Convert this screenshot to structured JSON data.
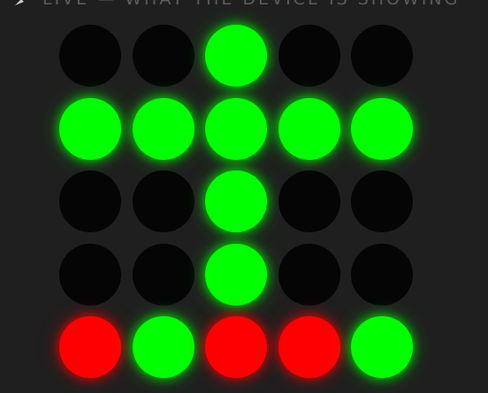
{
  "header": {
    "title": "LIVE — WHAT THE DEVICE IS SHOWING",
    "icon": "broadcast-icon"
  },
  "colors": {
    "background": "#1f1f1f",
    "led_off": "#050505",
    "green": "#00ff00",
    "red": "#ff0000",
    "header_text": "#5c5c5c"
  },
  "matrix": {
    "rows": [
      [
        "off",
        "off",
        "green",
        "off",
        "off"
      ],
      [
        "green",
        "green",
        "green",
        "green",
        "green"
      ],
      [
        "off",
        "off",
        "green",
        "off",
        "off"
      ],
      [
        "off",
        "off",
        "green",
        "off",
        "off"
      ],
      [
        "red",
        "green",
        "red",
        "red",
        "green"
      ]
    ]
  }
}
